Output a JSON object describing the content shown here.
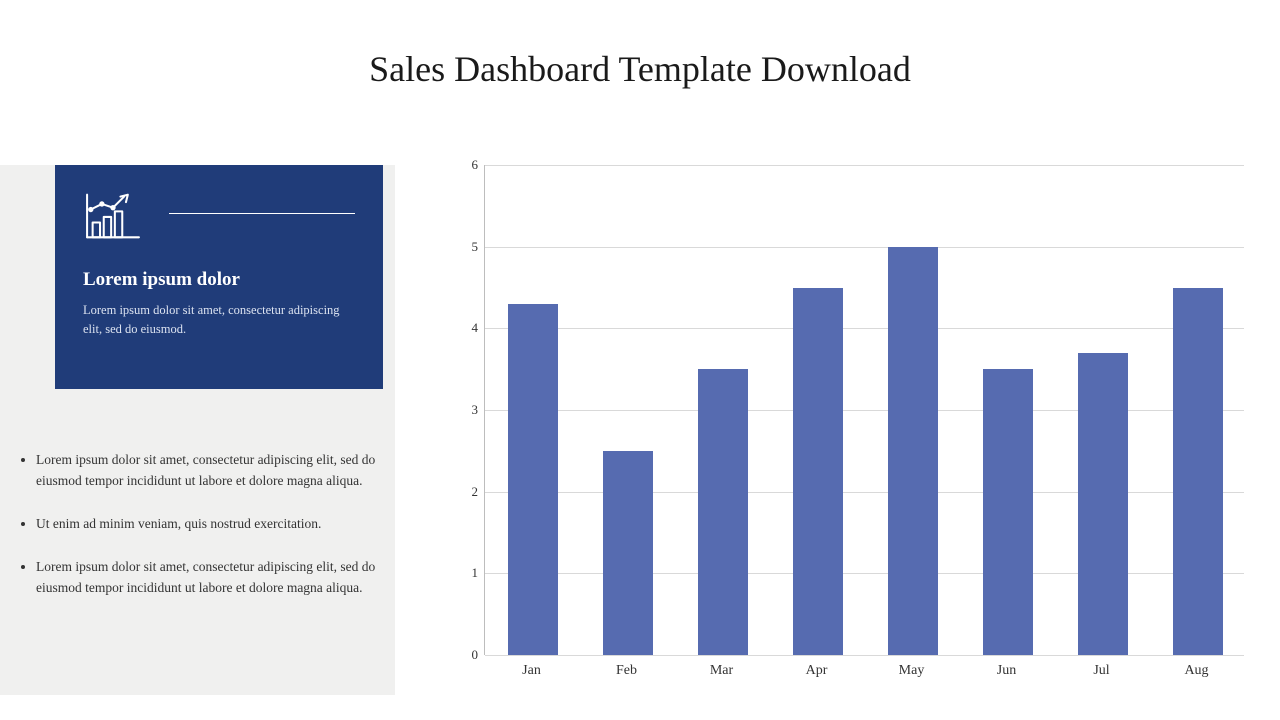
{
  "title": "Sales Dashboard Template Download",
  "colors": {
    "card_bg": "#203c79",
    "bar_fill": "#566bb0",
    "panel_bg": "#f0f0ef"
  },
  "card": {
    "icon_name": "bar-chart-growth-icon",
    "heading": "Lorem ipsum dolor",
    "body": "Lorem ipsum dolor sit amet, consectetur adipiscing elit, sed do eiusmod."
  },
  "bullets": [
    "Lorem ipsum dolor sit amet, consectetur adipiscing elit, sed do eiusmod tempor incididunt ut labore et dolore magna aliqua.",
    "Ut enim ad minim veniam, quis nostrud exercitation.",
    "Lorem ipsum dolor sit amet, consectetur adipiscing elit, sed do eiusmod tempor incididunt ut labore et dolore magna aliqua."
  ],
  "chart_data": {
    "type": "bar",
    "categories": [
      "Jan",
      "Feb",
      "Mar",
      "Apr",
      "May",
      "Jun",
      "Jul",
      "Aug"
    ],
    "values": [
      4.3,
      2.5,
      3.5,
      4.5,
      5.0,
      3.5,
      3.7,
      4.5
    ],
    "title": "",
    "xlabel": "",
    "ylabel": "",
    "ylim": [
      0,
      6
    ],
    "yticks": [
      0,
      1,
      2,
      3,
      4,
      5,
      6
    ],
    "grid": true
  }
}
